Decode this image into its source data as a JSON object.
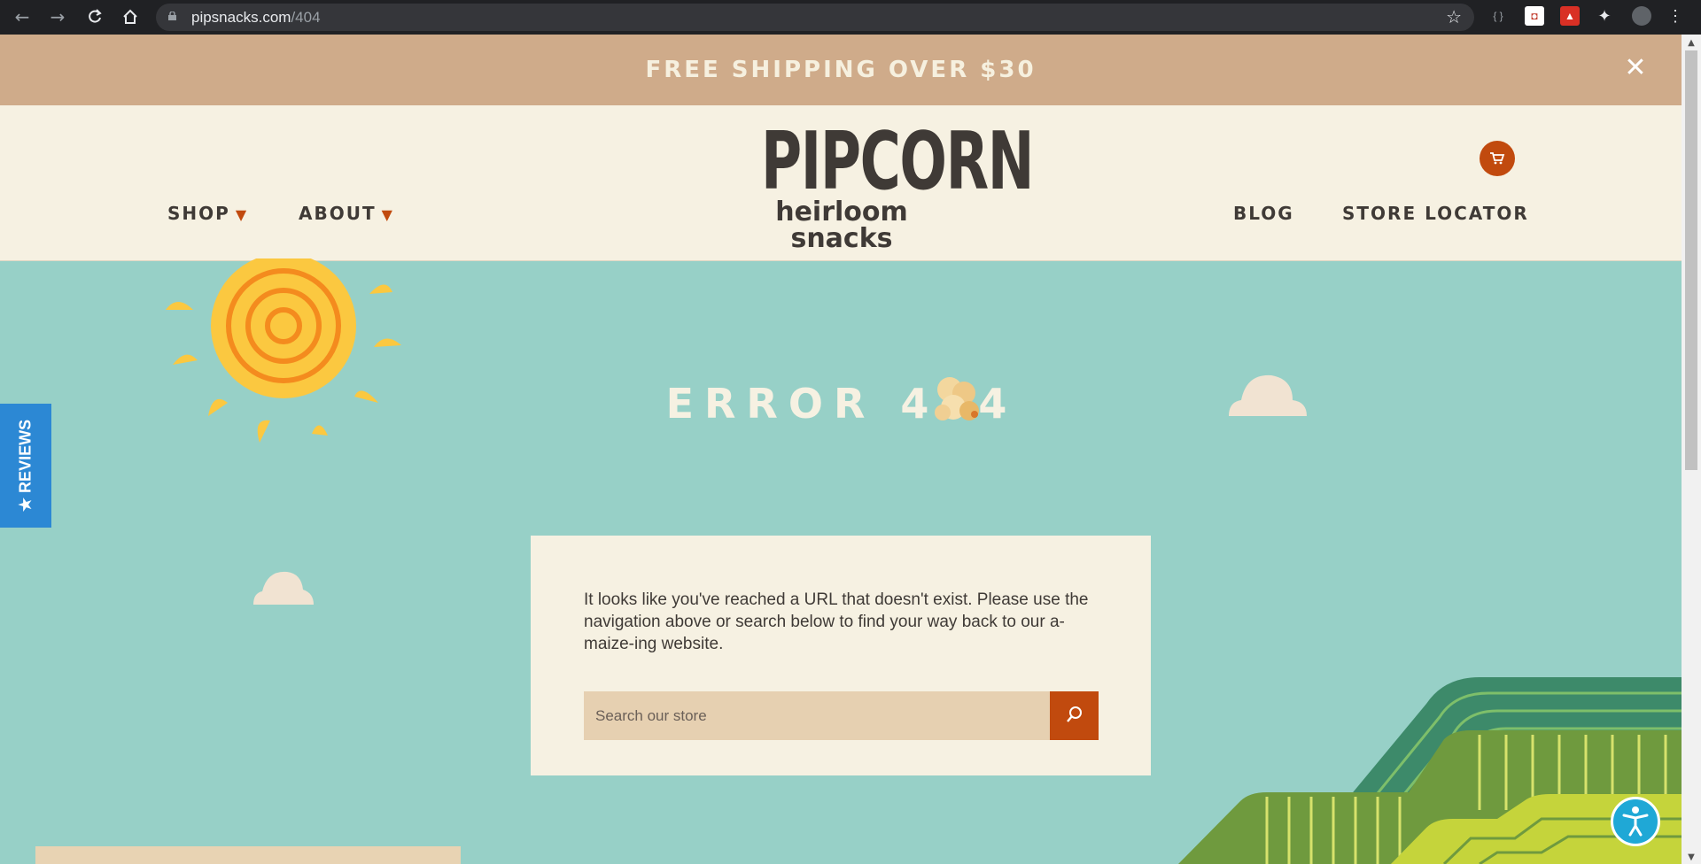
{
  "browser": {
    "url_host": "pipsnacks.com",
    "url_path": "/404"
  },
  "announcement": {
    "text": "FREE SHIPPING OVER $30"
  },
  "header": {
    "nav_left": [
      "SHOP",
      "ABOUT"
    ],
    "nav_right": [
      "BLOG",
      "STORE LOCATOR"
    ],
    "logo_word": "PIPCORN",
    "logo_sub": "heirloom snacks"
  },
  "hero": {
    "error_prefix": "ERROR 4",
    "error_suffix": "4"
  },
  "reviews_tab": {
    "label": "★ REVIEWS"
  },
  "card": {
    "message": "It looks like you've reached a URL that doesn't exist. Please use the navigation above or search below to find your way back to our a-maize-ing website.",
    "search_placeholder": "Search our store"
  },
  "colors": {
    "sky": "#97d0c7",
    "cream": "#f6f1e2",
    "tan": "#cfab8a",
    "accent": "#c14a0e",
    "text": "#3f3a36",
    "reviews_blue": "#2c88d4"
  }
}
